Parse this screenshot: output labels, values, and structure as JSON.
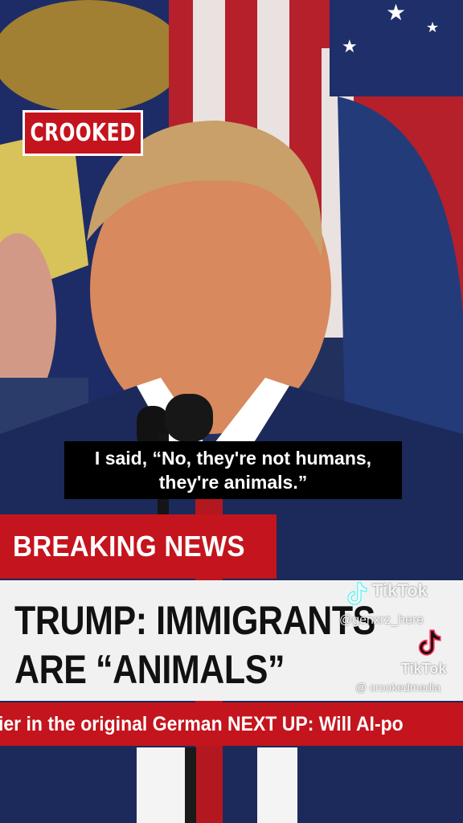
{
  "brand": {
    "logo_text": "CROOKED"
  },
  "caption": {
    "line1": "I said, “No, they're not humans,",
    "line2": "they're animals.”"
  },
  "banner": {
    "label": "BREAKING NEWS"
  },
  "headline": {
    "line1": "TRUMP: IMMIGRANTS",
    "line2": "ARE “ANIMALS”"
  },
  "ticker": {
    "text": "ier in the original German NEXT UP: Will AI-po"
  },
  "watermarks": {
    "tiktok_label_1": "TikTok",
    "handle_1": "@genxrz_here",
    "tiktok_label_2": "TikTok",
    "handle_2": "@ crookedmedia"
  },
  "colors": {
    "banner_red": "#c4141d",
    "panel_light": "#f1f1f1",
    "caption_bg": "#000000",
    "suit_navy": "#1b2a5a"
  }
}
